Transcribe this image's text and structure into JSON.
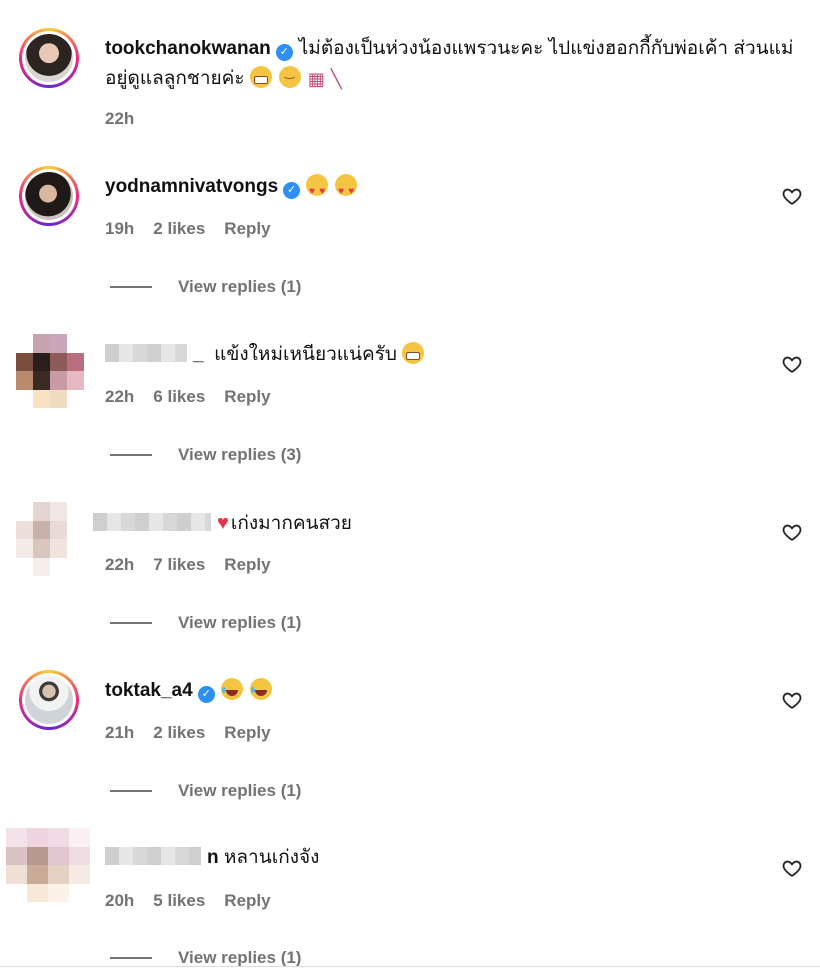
{
  "comments": [
    {
      "username": "tookchanokwanan",
      "text": "ไม่ต้องเป็นห่วงน้องแพรวนะคะ ไปแข่งฮอกกี้กับพ่อเค้า ส่วนแม่อยู่ดูแลลูกชายค่ะ",
      "time": "22h"
    },
    {
      "username": "yodnamnivatvongs",
      "time": "19h",
      "likes": "2 likes",
      "reply": "Reply",
      "view_replies": "View replies (1)"
    },
    {
      "username": "_",
      "text": "แข้งใหม่เหนียวแน่ครับ",
      "time": "22h",
      "likes": "6 likes",
      "reply": "Reply",
      "view_replies": "View replies (3)"
    },
    {
      "text": "เก่งมากคนสวย",
      "time": "22h",
      "likes": "7 likes",
      "reply": "Reply",
      "view_replies": "View replies (1)"
    },
    {
      "username": "toktak_a4",
      "time": "21h",
      "likes": "2 likes",
      "reply": "Reply",
      "view_replies": "View replies (1)"
    },
    {
      "username": "n",
      "text": "หลานเก่งจัง",
      "time": "20h",
      "likes": "5 likes",
      "reply": "Reply",
      "view_replies": "View replies (1)"
    }
  ],
  "icons": {
    "verified": "verified-badge-icon",
    "like": "heart-outline-icon",
    "goal": "hockey-goal-icon",
    "stick": "hockey-stick-icon"
  },
  "colors": {
    "verified": "#2f8ff5",
    "meta_text": "#737373",
    "username": "#111111"
  }
}
